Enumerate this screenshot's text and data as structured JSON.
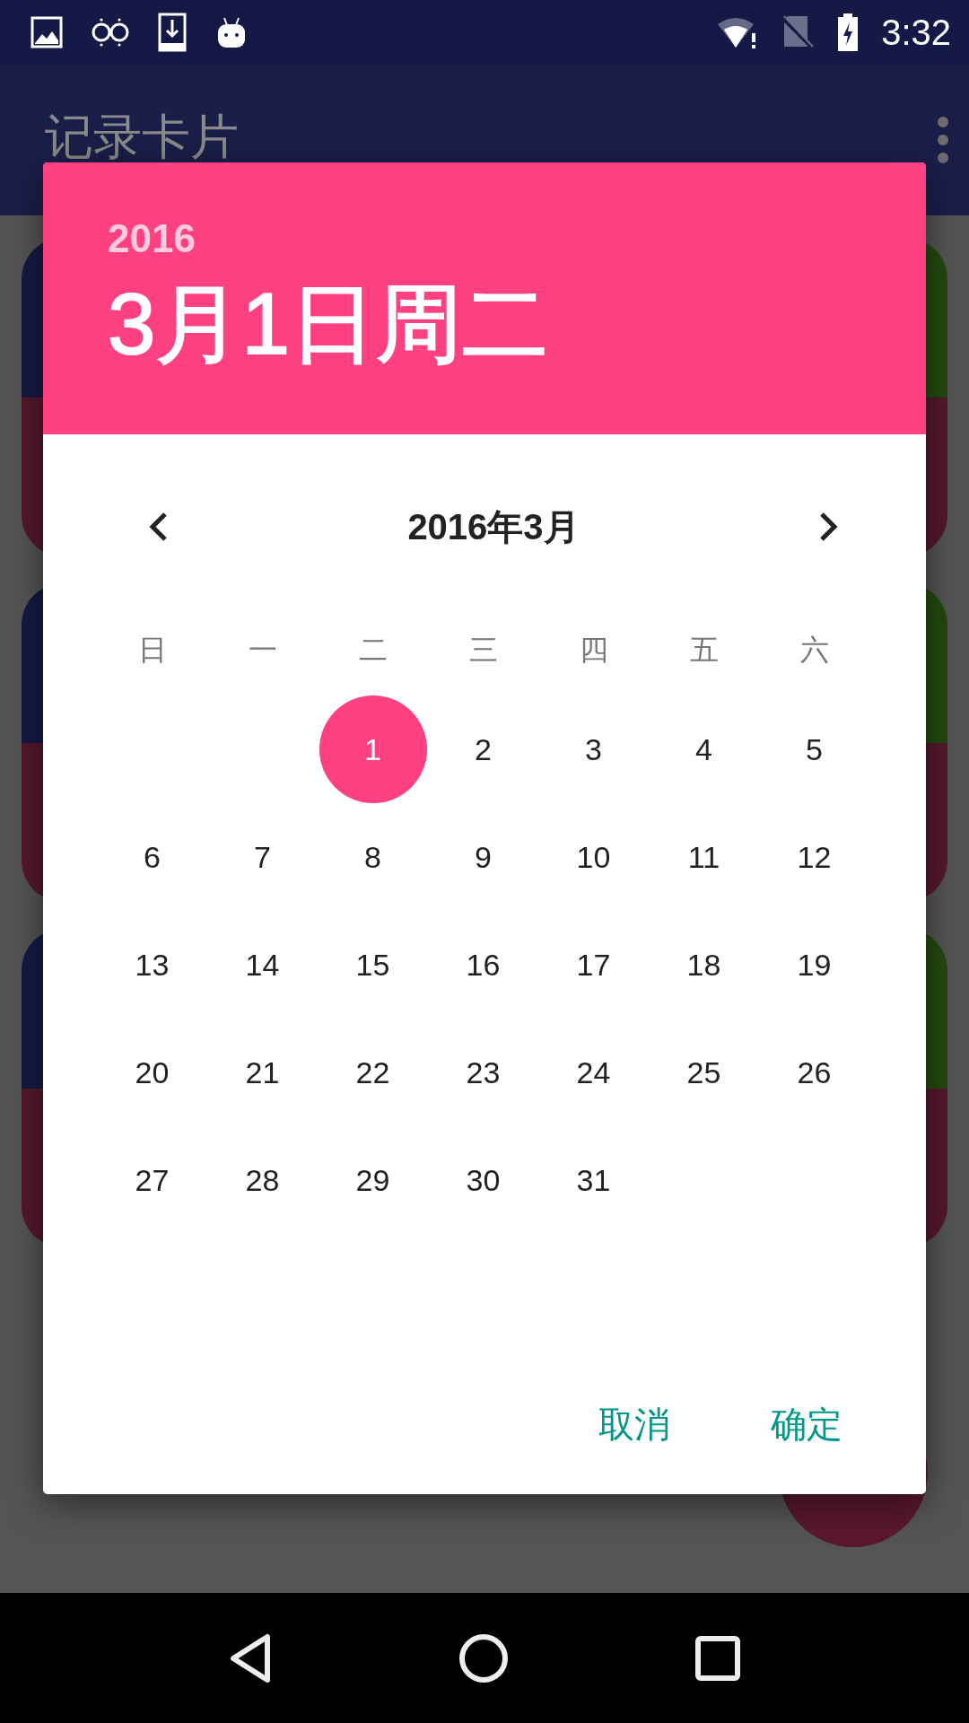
{
  "status_bar": {
    "time": "3:32"
  },
  "app_bar": {
    "title": "记录卡片"
  },
  "dialog": {
    "header": {
      "year": "2016",
      "date": "3月1日周二"
    },
    "calendar": {
      "month_title": "2016年3月",
      "weekdays": [
        "日",
        "一",
        "二",
        "三",
        "四",
        "五",
        "六"
      ],
      "weeks": [
        [
          {
            "kind": "empty"
          },
          {
            "kind": "empty"
          },
          {
            "kind": "day",
            "label": "1",
            "selected": true
          },
          {
            "kind": "day",
            "label": "2",
            "selected": false
          },
          {
            "kind": "day",
            "label": "3",
            "selected": false
          },
          {
            "kind": "day",
            "label": "4",
            "selected": false
          },
          {
            "kind": "day",
            "label": "5",
            "selected": false
          }
        ],
        [
          {
            "kind": "day",
            "label": "6",
            "selected": false
          },
          {
            "kind": "day",
            "label": "7",
            "selected": false
          },
          {
            "kind": "day",
            "label": "8",
            "selected": false
          },
          {
            "kind": "day",
            "label": "9",
            "selected": false
          },
          {
            "kind": "day",
            "label": "10",
            "selected": false
          },
          {
            "kind": "day",
            "label": "11",
            "selected": false
          },
          {
            "kind": "day",
            "label": "12",
            "selected": false
          }
        ],
        [
          {
            "kind": "day",
            "label": "13",
            "selected": false
          },
          {
            "kind": "day",
            "label": "14",
            "selected": false
          },
          {
            "kind": "day",
            "label": "15",
            "selected": false
          },
          {
            "kind": "day",
            "label": "16",
            "selected": false
          },
          {
            "kind": "day",
            "label": "17",
            "selected": false
          },
          {
            "kind": "day",
            "label": "18",
            "selected": false
          },
          {
            "kind": "day",
            "label": "19",
            "selected": false
          }
        ],
        [
          {
            "kind": "day",
            "label": "20",
            "selected": false
          },
          {
            "kind": "day",
            "label": "21",
            "selected": false
          },
          {
            "kind": "day",
            "label": "22",
            "selected": false
          },
          {
            "kind": "day",
            "label": "23",
            "selected": false
          },
          {
            "kind": "day",
            "label": "24",
            "selected": false
          },
          {
            "kind": "day",
            "label": "25",
            "selected": false
          },
          {
            "kind": "day",
            "label": "26",
            "selected": false
          }
        ],
        [
          {
            "kind": "day",
            "label": "27",
            "selected": false
          },
          {
            "kind": "day",
            "label": "28",
            "selected": false
          },
          {
            "kind": "day",
            "label": "29",
            "selected": false
          },
          {
            "kind": "day",
            "label": "30",
            "selected": false
          },
          {
            "kind": "day",
            "label": "31",
            "selected": false
          },
          {
            "kind": "empty"
          },
          {
            "kind": "empty"
          }
        ]
      ]
    },
    "buttons": [
      "取消",
      "确定"
    ]
  }
}
